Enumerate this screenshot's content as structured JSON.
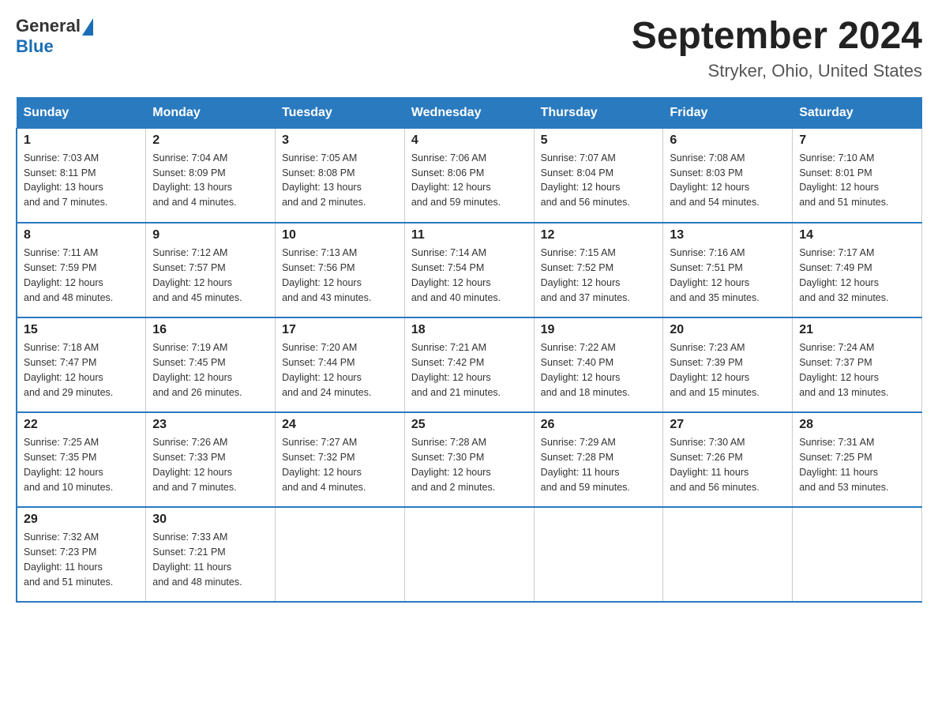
{
  "header": {
    "logo": {
      "general": "General",
      "blue": "Blue"
    },
    "title": "September 2024",
    "subtitle": "Stryker, Ohio, United States"
  },
  "days_of_week": [
    "Sunday",
    "Monday",
    "Tuesday",
    "Wednesday",
    "Thursday",
    "Friday",
    "Saturday"
  ],
  "weeks": [
    [
      {
        "day": "1",
        "sunrise": "7:03 AM",
        "sunset": "8:11 PM",
        "daylight": "13 hours and 7 minutes."
      },
      {
        "day": "2",
        "sunrise": "7:04 AM",
        "sunset": "8:09 PM",
        "daylight": "13 hours and 4 minutes."
      },
      {
        "day": "3",
        "sunrise": "7:05 AM",
        "sunset": "8:08 PM",
        "daylight": "13 hours and 2 minutes."
      },
      {
        "day": "4",
        "sunrise": "7:06 AM",
        "sunset": "8:06 PM",
        "daylight": "12 hours and 59 minutes."
      },
      {
        "day": "5",
        "sunrise": "7:07 AM",
        "sunset": "8:04 PM",
        "daylight": "12 hours and 56 minutes."
      },
      {
        "day": "6",
        "sunrise": "7:08 AM",
        "sunset": "8:03 PM",
        "daylight": "12 hours and 54 minutes."
      },
      {
        "day": "7",
        "sunrise": "7:10 AM",
        "sunset": "8:01 PM",
        "daylight": "12 hours and 51 minutes."
      }
    ],
    [
      {
        "day": "8",
        "sunrise": "7:11 AM",
        "sunset": "7:59 PM",
        "daylight": "12 hours and 48 minutes."
      },
      {
        "day": "9",
        "sunrise": "7:12 AM",
        "sunset": "7:57 PM",
        "daylight": "12 hours and 45 minutes."
      },
      {
        "day": "10",
        "sunrise": "7:13 AM",
        "sunset": "7:56 PM",
        "daylight": "12 hours and 43 minutes."
      },
      {
        "day": "11",
        "sunrise": "7:14 AM",
        "sunset": "7:54 PM",
        "daylight": "12 hours and 40 minutes."
      },
      {
        "day": "12",
        "sunrise": "7:15 AM",
        "sunset": "7:52 PM",
        "daylight": "12 hours and 37 minutes."
      },
      {
        "day": "13",
        "sunrise": "7:16 AM",
        "sunset": "7:51 PM",
        "daylight": "12 hours and 35 minutes."
      },
      {
        "day": "14",
        "sunrise": "7:17 AM",
        "sunset": "7:49 PM",
        "daylight": "12 hours and 32 minutes."
      }
    ],
    [
      {
        "day": "15",
        "sunrise": "7:18 AM",
        "sunset": "7:47 PM",
        "daylight": "12 hours and 29 minutes."
      },
      {
        "day": "16",
        "sunrise": "7:19 AM",
        "sunset": "7:45 PM",
        "daylight": "12 hours and 26 minutes."
      },
      {
        "day": "17",
        "sunrise": "7:20 AM",
        "sunset": "7:44 PM",
        "daylight": "12 hours and 24 minutes."
      },
      {
        "day": "18",
        "sunrise": "7:21 AM",
        "sunset": "7:42 PM",
        "daylight": "12 hours and 21 minutes."
      },
      {
        "day": "19",
        "sunrise": "7:22 AM",
        "sunset": "7:40 PM",
        "daylight": "12 hours and 18 minutes."
      },
      {
        "day": "20",
        "sunrise": "7:23 AM",
        "sunset": "7:39 PM",
        "daylight": "12 hours and 15 minutes."
      },
      {
        "day": "21",
        "sunrise": "7:24 AM",
        "sunset": "7:37 PM",
        "daylight": "12 hours and 13 minutes."
      }
    ],
    [
      {
        "day": "22",
        "sunrise": "7:25 AM",
        "sunset": "7:35 PM",
        "daylight": "12 hours and 10 minutes."
      },
      {
        "day": "23",
        "sunrise": "7:26 AM",
        "sunset": "7:33 PM",
        "daylight": "12 hours and 7 minutes."
      },
      {
        "day": "24",
        "sunrise": "7:27 AM",
        "sunset": "7:32 PM",
        "daylight": "12 hours and 4 minutes."
      },
      {
        "day": "25",
        "sunrise": "7:28 AM",
        "sunset": "7:30 PM",
        "daylight": "12 hours and 2 minutes."
      },
      {
        "day": "26",
        "sunrise": "7:29 AM",
        "sunset": "7:28 PM",
        "daylight": "11 hours and 59 minutes."
      },
      {
        "day": "27",
        "sunrise": "7:30 AM",
        "sunset": "7:26 PM",
        "daylight": "11 hours and 56 minutes."
      },
      {
        "day": "28",
        "sunrise": "7:31 AM",
        "sunset": "7:25 PM",
        "daylight": "11 hours and 53 minutes."
      }
    ],
    [
      {
        "day": "29",
        "sunrise": "7:32 AM",
        "sunset": "7:23 PM",
        "daylight": "11 hours and 51 minutes."
      },
      {
        "day": "30",
        "sunrise": "7:33 AM",
        "sunset": "7:21 PM",
        "daylight": "11 hours and 48 minutes."
      },
      null,
      null,
      null,
      null,
      null
    ]
  ],
  "labels": {
    "sunrise": "Sunrise:",
    "sunset": "Sunset:",
    "daylight": "Daylight:"
  }
}
